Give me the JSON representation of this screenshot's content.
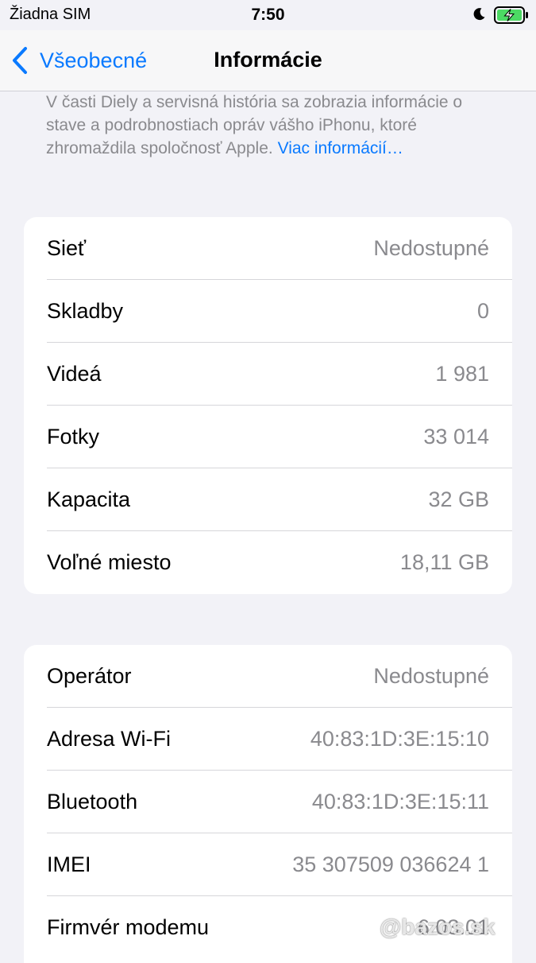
{
  "status_bar": {
    "carrier": "Žiadna SIM",
    "time": "7:50",
    "icons": [
      "moon-icon",
      "battery-charging-icon"
    ],
    "battery_color": "#4cd964"
  },
  "nav": {
    "back_label": "Všeobecné",
    "title": "Informácie",
    "accent_color": "#0a7aff"
  },
  "info": {
    "text": "V časti Diely a servisná história sa zobrazia informácie o stave a podrobnostiach opráv vášho iPhonu, ktoré zhromaždila spoločnosť Apple.",
    "link": "Viac informácií…"
  },
  "group1": [
    {
      "label": "Sieť",
      "value": "Nedostupné"
    },
    {
      "label": "Skladby",
      "value": "0"
    },
    {
      "label": "Videá",
      "value": "1 981"
    },
    {
      "label": "Fotky",
      "value": "33 014"
    },
    {
      "label": "Kapacita",
      "value": "32 GB"
    },
    {
      "label": "Voľné miesto",
      "value": "18,11 GB"
    }
  ],
  "group2": [
    {
      "label": "Operátor",
      "value": "Nedostupné"
    },
    {
      "label": "Adresa Wi-Fi",
      "value": "40:83:1D:3E:15:10"
    },
    {
      "label": "Bluetooth",
      "value": "40:83:1D:3E:15:11"
    },
    {
      "label": "IMEI",
      "value": "35 307509 036624 1"
    },
    {
      "label": "Firmvér modemu",
      "value": "6.03.01"
    }
  ],
  "watermark": "@bazos.sk"
}
